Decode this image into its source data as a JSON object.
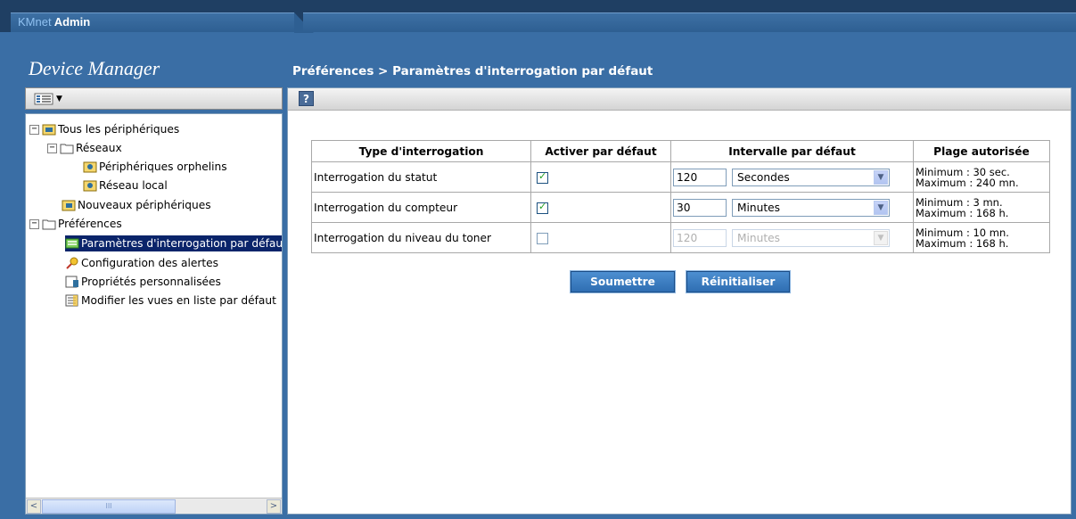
{
  "brand": {
    "prefix": "KMnet",
    "suffix": "Admin"
  },
  "app_title": "Device Manager",
  "page_title": "Préférences > Paramètres d'interrogation par défaut",
  "tree": {
    "root": "Tous les périphériques",
    "networks": "Réseaux",
    "orphans": "Périphériques orphelins",
    "local": "Réseau local",
    "new_devices": "Nouveaux périphériques",
    "preferences": "Préférences",
    "polling": "Paramètres d'interrogation par défaut",
    "alerts": "Configuration des alertes",
    "custom_props": "Propriétés personnalisées",
    "list_views": "Modifier les vues en liste par défaut"
  },
  "table": {
    "headers": [
      "Type d'interrogation",
      "Activer par défaut",
      "Intervalle par défaut",
      "Plage autorisée"
    ],
    "rows": [
      {
        "type": "Interrogation du statut",
        "enabled": true,
        "interval": "120",
        "unit": "Secondes",
        "range_min": "Minimum : 30 sec.",
        "range_max": "Maximum : 240 mn."
      },
      {
        "type": "Interrogation du compteur",
        "enabled": true,
        "interval": "30",
        "unit": "Minutes",
        "range_min": "Minimum : 3 mn.",
        "range_max": "Maximum : 168 h."
      },
      {
        "type": "Interrogation du niveau du toner",
        "enabled": false,
        "interval": "120",
        "unit": "Minutes",
        "range_min": "Minimum : 10 mn.",
        "range_max": "Maximum : 168 h."
      }
    ]
  },
  "buttons": {
    "submit": "Soumettre",
    "reset": "Réinitialiser"
  },
  "help_label": "?",
  "scroll_glyphs": {
    "left": "<",
    "right": ">",
    "thumb": "III"
  },
  "colors": {
    "background": "#3a6ea5",
    "selected": "#0a246a",
    "button": "#2f6eb2"
  }
}
